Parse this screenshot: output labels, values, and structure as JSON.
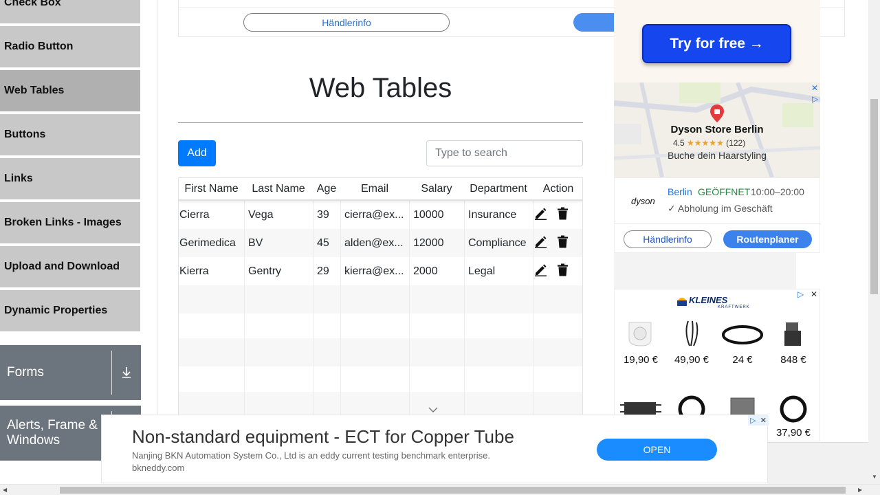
{
  "sidebar": {
    "items": [
      {
        "label": "Check Box"
      },
      {
        "label": "Radio Button"
      },
      {
        "label": "Web Tables"
      },
      {
        "label": "Buttons"
      },
      {
        "label": "Links"
      },
      {
        "label": "Broken Links - Images"
      },
      {
        "label": "Upload and Download"
      },
      {
        "label": "Dynamic Properties"
      }
    ],
    "groups": [
      {
        "label": "Forms"
      },
      {
        "label": "Alerts, Frame & Windows"
      }
    ]
  },
  "top_ad": {
    "haendlerinfo": "Händlerinfo"
  },
  "main": {
    "title": "Web Tables",
    "add_label": "Add",
    "search_placeholder": "Type to search",
    "columns": [
      "First Name",
      "Last Name",
      "Age",
      "Email",
      "Salary",
      "Department",
      "Action"
    ],
    "rows": [
      [
        "Cierra",
        "Vega",
        "39",
        "cierra@ex...",
        "10000",
        "Insurance"
      ],
      [
        "Gerimedica",
        "BV",
        "45",
        "alden@ex...",
        "12000",
        "Compliance"
      ],
      [
        "Kierra",
        "Gentry",
        "29",
        "kierra@ex...",
        "2000",
        "Legal"
      ]
    ]
  },
  "right_ad": {
    "try_label": "Try for free →",
    "map": {
      "store_name": "Dyson Store Berlin",
      "rating": "4.5",
      "stars": "★★★★★",
      "reviews": "(122)",
      "subtitle": "Buche dein Haarstyling"
    },
    "store": {
      "logo": "dyson",
      "city": "Berlin",
      "status": "GEÖFFNET",
      "hours": "10:00–20:00",
      "pickup": "✓ Abholung im Geschäft",
      "info_button": "Händlerinfo",
      "route_button": "Routenplaner"
    }
  },
  "right_ad2": {
    "brand": "KLEINES",
    "brand_sub": "KRAFTWERK",
    "prices": [
      "19,90 €",
      "49,90 €",
      "24 €",
      "848 €",
      "",
      "",
      "",
      "37,90 €"
    ]
  },
  "bottom_ad": {
    "title": "Non-standard equipment - ECT for Copper Tube",
    "description": "Nanjing BKN Automation System Co., Ltd is an eddy current testing benchmark enterprise.",
    "url": "bkneddy.com",
    "button": "OPEN"
  },
  "colors": {
    "primary": "#007bff",
    "sidebar_bg": "#c8c8c8",
    "sidebar_active": "#b0b0b0",
    "group_bg": "#6c757d"
  }
}
